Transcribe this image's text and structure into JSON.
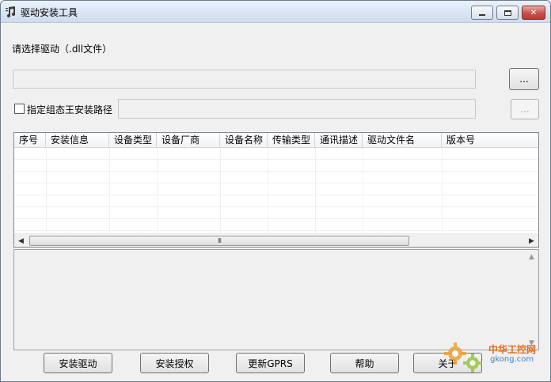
{
  "window": {
    "title": "驱动安装工具",
    "icon": "music-note-app-icon",
    "controls": {
      "minimize": "minimize-icon",
      "maximize": "maximize-icon",
      "close": "close-icon"
    }
  },
  "driver_select": {
    "label": "请选择驱动（.dll文件）",
    "path_value": "",
    "browse_label": "..."
  },
  "install_path": {
    "checkbox_label": "指定组态王安装路径",
    "checked": false,
    "path_value": "",
    "browse_label": "..."
  },
  "table": {
    "columns": [
      "序号",
      "安装信息",
      "设备类型",
      "设备厂商",
      "设备名称",
      "传输类型",
      "通讯描述",
      "驱动文件名",
      "版本号"
    ],
    "rows": [],
    "scroll_thumb_glyph": "III"
  },
  "log": {
    "text": ""
  },
  "buttons": {
    "install_driver": "安装驱动",
    "install_license": "安装授权",
    "update_gprs": "更新GPRS",
    "help": "帮助",
    "about": "关于"
  },
  "watermark": {
    "brand": "中华工控网",
    "domain": "gkong.com"
  },
  "colors": {
    "accent_orange": "#e46b1c",
    "accent_blue": "#3f7fc6",
    "window_bg": "#f0f0f0"
  }
}
